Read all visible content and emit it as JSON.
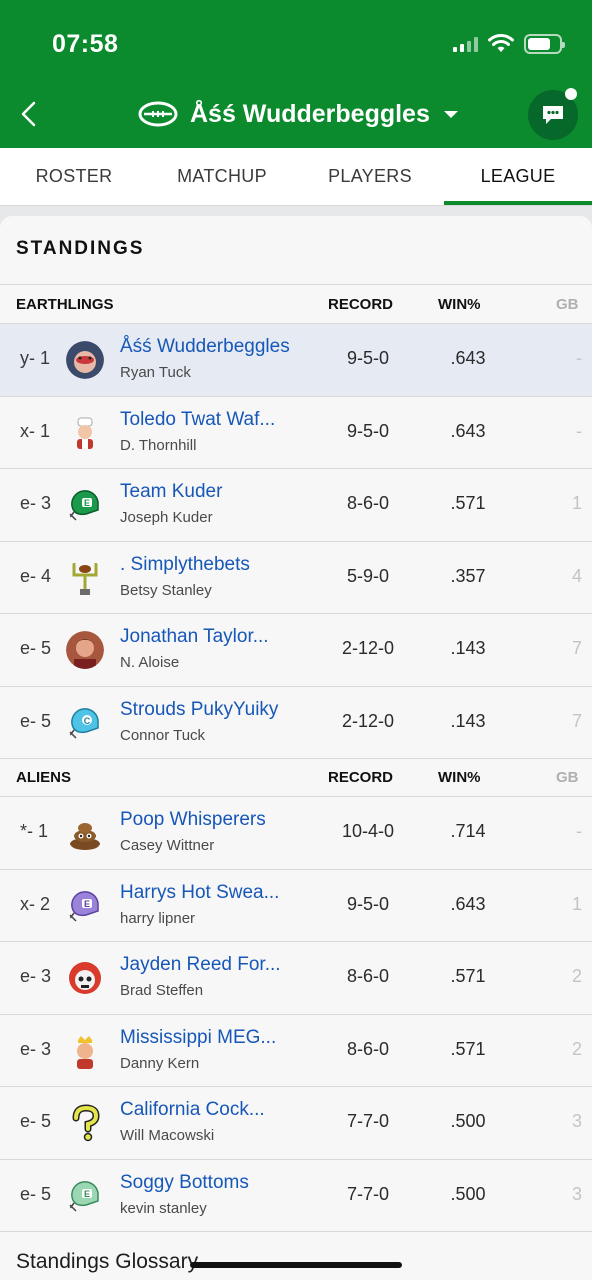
{
  "status": {
    "time": "07:58"
  },
  "header": {
    "title": "Åśś Wudderbeggles"
  },
  "tabs": [
    "ROSTER",
    "MATCHUP",
    "PLAYERS",
    "LEAGUE"
  ],
  "active_tab": "LEAGUE",
  "card": {
    "title": "STANDINGS"
  },
  "columns": {
    "record": "RECORD",
    "win_pct": "WIN%",
    "gb": "GB"
  },
  "divisions": [
    {
      "name": "EARTHLINGS",
      "teams": [
        {
          "seed": "y- 1",
          "team": "Åśś Wudderbeggles",
          "owner": "Ryan Tuck",
          "record": "9-5-0",
          "win_pct": ".643",
          "gb": "-",
          "avatar_icon": "face-avatar-icon",
          "highlight": true
        },
        {
          "seed": "x- 1",
          "team": "Toledo Twat Waf...",
          "owner": "D. Thornhill",
          "record": "9-5-0",
          "win_pct": ".643",
          "gb": "-",
          "avatar_icon": "chef-avatar-icon"
        },
        {
          "seed": "e- 3",
          "team": "Team Kuder",
          "owner": "Joseph Kuder",
          "record": "8-6-0",
          "win_pct": ".571",
          "gb": "1",
          "avatar_icon": "green-helmet-icon"
        },
        {
          "seed": "e- 4",
          "team": ". Simplythebets",
          "owner": "Betsy Stanley",
          "record": "5-9-0",
          "win_pct": ".357",
          "gb": "4",
          "avatar_icon": "goalpost-avatar-icon"
        },
        {
          "seed": "e- 5",
          "team": "Jonathan Taylor...",
          "owner": "N. Aloise",
          "record": "2-12-0",
          "win_pct": ".143",
          "gb": "7",
          "avatar_icon": "photo-avatar-icon"
        },
        {
          "seed": "e- 5",
          "team": "Strouds PukyYuiky",
          "owner": "Connor Tuck",
          "record": "2-12-0",
          "win_pct": ".143",
          "gb": "7",
          "avatar_icon": "blue-helmet-icon"
        }
      ]
    },
    {
      "name": "ALIENS",
      "teams": [
        {
          "seed": "*- 1",
          "team": "Poop Whisperers",
          "owner": "Casey Wittner",
          "record": "10-4-0",
          "win_pct": ".714",
          "gb": "-",
          "avatar_icon": "poop-avatar-icon"
        },
        {
          "seed": "x- 2",
          "team": "Harrys Hot Swea...",
          "owner": "harry lipner",
          "record": "9-5-0",
          "win_pct": ".643",
          "gb": "1",
          "avatar_icon": "purple-helmet-icon"
        },
        {
          "seed": "e- 3",
          "team": "Jayden Reed For...",
          "owner": "Brad Steffen",
          "record": "8-6-0",
          "win_pct": ".571",
          "gb": "2",
          "avatar_icon": "skull-helmet-icon"
        },
        {
          "seed": "e- 3",
          "team": "Mississippi MEG...",
          "owner": "Danny Kern",
          "record": "8-6-0",
          "win_pct": ".571",
          "gb": "2",
          "avatar_icon": "king-avatar-icon"
        },
        {
          "seed": "e- 5",
          "team": "California Cock...",
          "owner": "Will Macowski",
          "record": "7-7-0",
          "win_pct": ".500",
          "gb": "3",
          "avatar_icon": "question-avatar-icon"
        },
        {
          "seed": "e- 5",
          "team": "Soggy Bottoms",
          "owner": "kevin stanley",
          "record": "7-7-0",
          "win_pct": ".500",
          "gb": "3",
          "avatar_icon": "mint-helmet-icon"
        }
      ]
    }
  ],
  "footer": {
    "glossary": "Standings Glossary"
  },
  "colors": {
    "brand_green": "#0c8a2e",
    "link_blue": "#1757b8",
    "highlight_row": "#e6ebf3"
  }
}
